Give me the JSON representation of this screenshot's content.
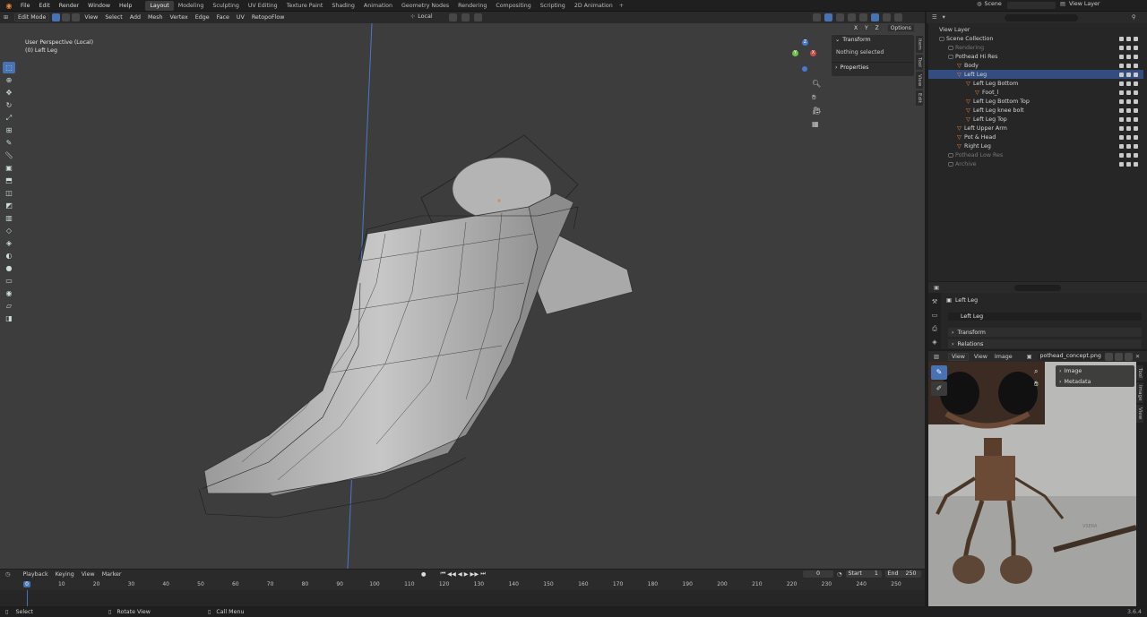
{
  "menu": [
    "File",
    "Edit",
    "Render",
    "Window",
    "Help"
  ],
  "workspaces": [
    {
      "label": "Layout",
      "active": true
    },
    {
      "label": "Modeling"
    },
    {
      "label": "Sculpting"
    },
    {
      "label": "UV Editing"
    },
    {
      "label": "Texture Paint"
    },
    {
      "label": "Shading"
    },
    {
      "label": "Animation"
    },
    {
      "label": "Rendering"
    },
    {
      "label": "Compositing"
    },
    {
      "label": "Geometry Nodes"
    },
    {
      "label": "Scripting"
    },
    {
      "label": "2D Animation"
    }
  ],
  "workspaces_order": [
    "Layout",
    "Modeling",
    "Sculpting",
    "UV Editing",
    "Texture Paint",
    "Shading",
    "Animation",
    "Geometry Nodes",
    "Rendering",
    "Compositing",
    "Scripting",
    "2D Animation"
  ],
  "scene": {
    "scene_label": "Scene",
    "view_layer_label": "View Layer"
  },
  "viewport_header": {
    "mode": "Edit Mode",
    "menus": [
      "View",
      "Select",
      "Add",
      "Mesh",
      "Vertex",
      "Edge",
      "Face",
      "UV"
    ],
    "addon": "RetopoFlow",
    "orientation": "Local",
    "options": "Options",
    "axes": [
      "X",
      "Y",
      "Z"
    ]
  },
  "viewport": {
    "perspective": "User Perspective (Local)",
    "object": "(0) Left Leg",
    "gizmo_axes": [
      "X",
      "Y",
      "Z"
    ]
  },
  "npanel": {
    "transform": "Transform",
    "nothing": "Nothing selected",
    "properties": "Properties",
    "tabs": [
      "Item",
      "Tool",
      "View",
      "Edit"
    ]
  },
  "outliner": {
    "view_layer": "View Layer",
    "rows": [
      {
        "label": "Scene Collection",
        "indent": 0,
        "dim": false
      },
      {
        "label": "Rendering",
        "indent": 1,
        "dim": true
      },
      {
        "label": "Pothead Hi Res",
        "indent": 1,
        "dim": false
      },
      {
        "label": "Body",
        "indent": 2,
        "dim": false
      },
      {
        "label": "Left Leg",
        "indent": 2,
        "dim": false,
        "selected": true
      },
      {
        "label": "Left Leg Bottom",
        "indent": 3,
        "dim": false
      },
      {
        "label": "Foot_l",
        "indent": 4,
        "dim": false
      },
      {
        "label": "Left Leg Bottom Top",
        "indent": 3,
        "dim": false
      },
      {
        "label": "Left Leg knee bolt",
        "indent": 3,
        "dim": false
      },
      {
        "label": "Left Leg Top",
        "indent": 3,
        "dim": false
      },
      {
        "label": "Left Upper Arm",
        "indent": 2,
        "dim": false
      },
      {
        "label": "Pot & Head",
        "indent": 2,
        "dim": false
      },
      {
        "label": "Right Leg",
        "indent": 2,
        "dim": false
      },
      {
        "label": "Pothead Low Res",
        "indent": 1,
        "dim": true
      },
      {
        "label": "Archive",
        "indent": 1,
        "dim": true
      }
    ]
  },
  "properties": {
    "object": "Left Leg",
    "object_field": "Left Leg",
    "sections": [
      "Transform",
      "Relations"
    ]
  },
  "image_editor": {
    "view": "View",
    "menus": [
      "View",
      "Image"
    ],
    "image_name": "pothead_concept.png",
    "sections": [
      "Image",
      "Metadata"
    ],
    "tabs": [
      "Tool",
      "Image",
      "View"
    ],
    "watermark": "VSERA"
  },
  "timeline": {
    "menus": [
      "Playback",
      "Keying",
      "View",
      "Marker"
    ],
    "current_frame": "0",
    "start_label": "Start",
    "start": "1",
    "end_label": "End",
    "end": "250",
    "ticks": [
      "0",
      "10",
      "20",
      "30",
      "40",
      "50",
      "60",
      "70",
      "80",
      "90",
      "100",
      "110",
      "120",
      "130",
      "140",
      "150",
      "160",
      "170",
      "180",
      "190",
      "200",
      "210",
      "220",
      "230",
      "240",
      "250"
    ],
    "playhead": "0"
  },
  "statusbar": {
    "select": "Select",
    "rotate": "Rotate View",
    "call_menu": "Call Menu",
    "version": "3.6.4"
  },
  "colors": {
    "accent": "#4772b3",
    "selected_row": "#334d80",
    "orange": "#e8853a",
    "viewport_bg": "#3d3d3d"
  }
}
